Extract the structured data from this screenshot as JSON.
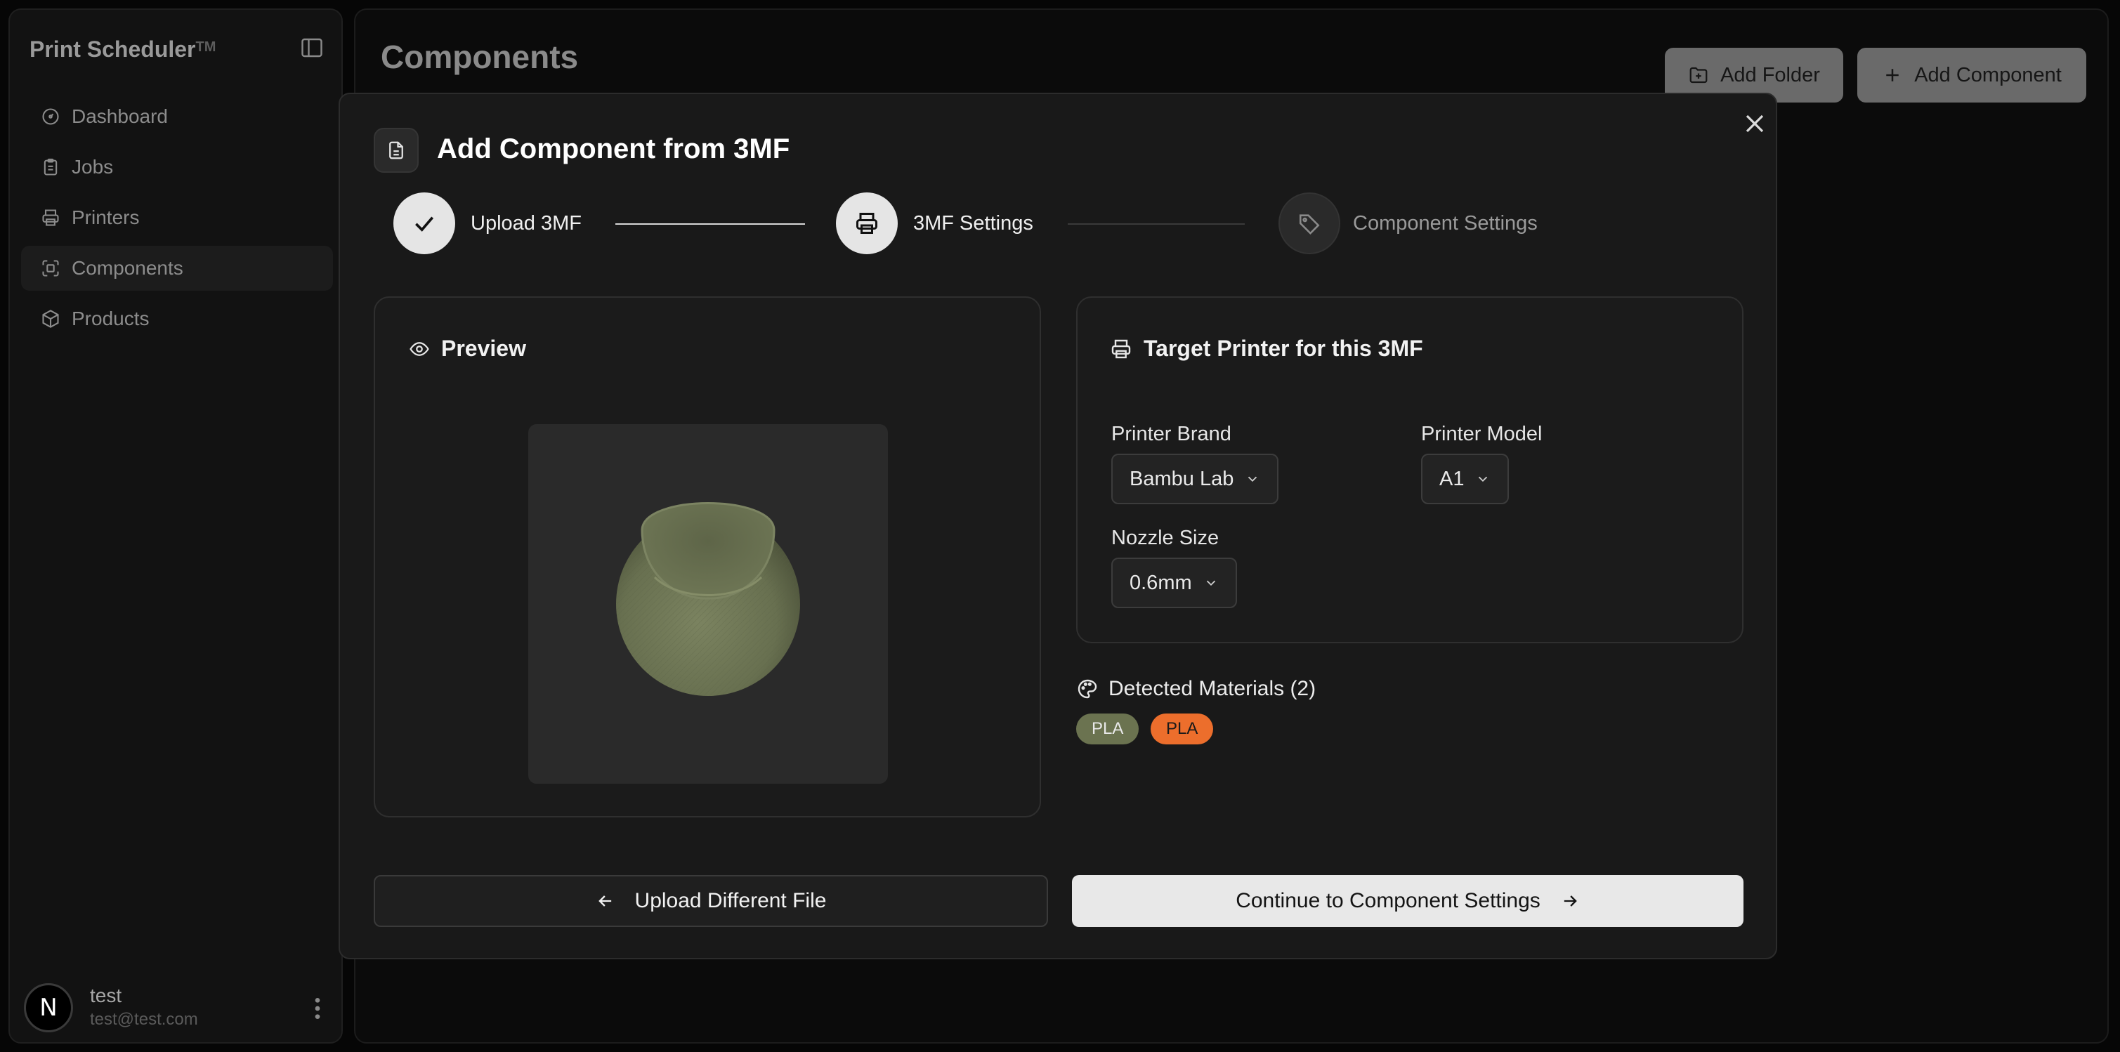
{
  "app": {
    "name": "Print Scheduler",
    "tm": "TM"
  },
  "sidebar": {
    "items": [
      {
        "label": "Dashboard",
        "icon": "gauge-icon"
      },
      {
        "label": "Jobs",
        "icon": "clipboard-icon"
      },
      {
        "label": "Printers",
        "icon": "printer-icon"
      },
      {
        "label": "Components",
        "icon": "scan-icon",
        "active": true
      },
      {
        "label": "Products",
        "icon": "package-icon"
      }
    ],
    "user": {
      "initial": "N",
      "name": "test",
      "email": "test@test.com"
    }
  },
  "page": {
    "title": "Components",
    "add_folder": "Add Folder",
    "add_component": "Add Component"
  },
  "modal": {
    "title": "Add Component from 3MF",
    "steps": [
      {
        "label": "Upload 3MF",
        "state": "done"
      },
      {
        "label": "3MF Settings",
        "state": "current"
      },
      {
        "label": "Component Settings",
        "state": "todo"
      }
    ],
    "preview": {
      "title": "Preview"
    },
    "target": {
      "title": "Target Printer for this 3MF",
      "brand_label": "Printer Brand",
      "brand_value": "Bambu Lab",
      "model_label": "Printer Model",
      "model_value": "A1",
      "nozzle_label": "Nozzle Size",
      "nozzle_value": "0.6mm"
    },
    "materials": {
      "title": "Detected Materials (2)",
      "chips": [
        {
          "label": "PLA",
          "color": "#6b7350"
        },
        {
          "label": "PLA",
          "color": "#ec6e2c"
        }
      ]
    },
    "buttons": {
      "back": "Upload Different File",
      "next": "Continue to Component Settings"
    }
  },
  "colors": {
    "background": "#060606",
    "modal": "#191919",
    "model_green": "#6b7350",
    "accent_orange": "#ec6e2c"
  }
}
